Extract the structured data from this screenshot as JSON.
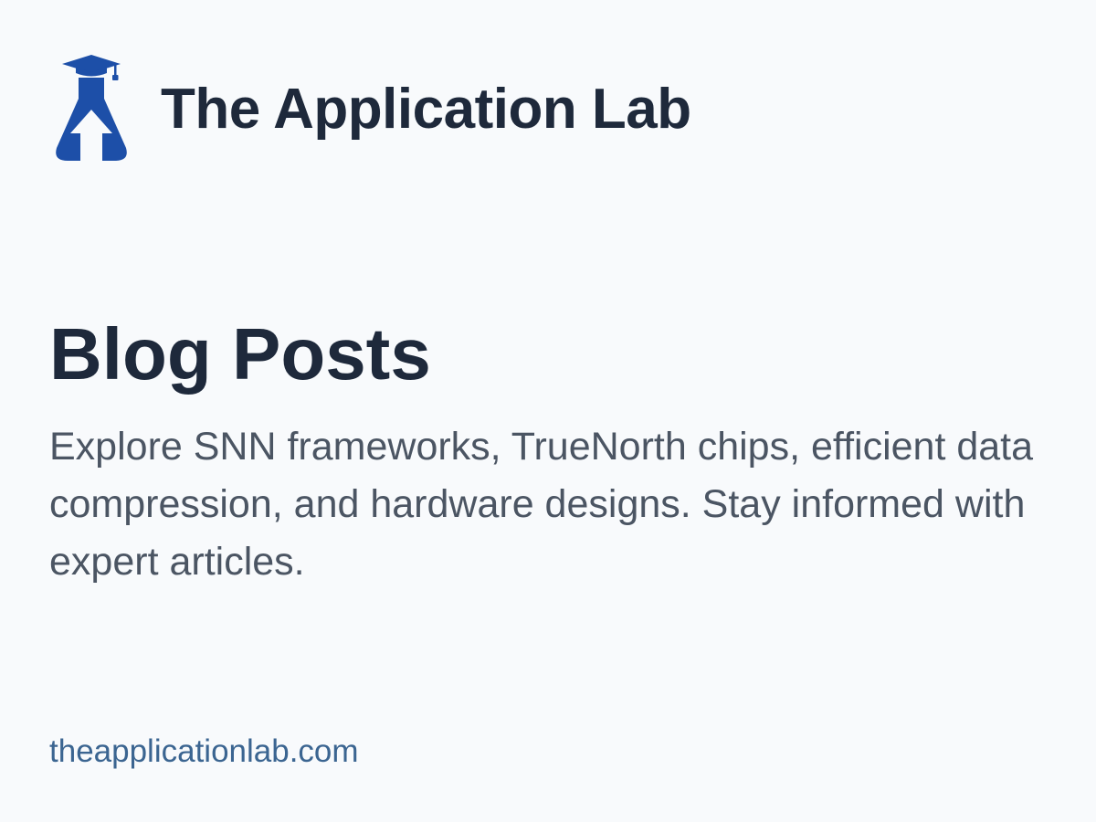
{
  "brand": {
    "name": "The Application Lab",
    "logo_icon": "graduation-cap-flask-arrow-icon",
    "logo_color": "#1d4fa8"
  },
  "main": {
    "title": "Blog Posts",
    "description": "Explore SNN frameworks, TrueNorth chips, efficient data compression, and hardware designs. Stay informed with expert articles."
  },
  "footer": {
    "url": "theapplicationlab.com"
  },
  "colors": {
    "background": "#f8fafc",
    "heading": "#1e293b",
    "body_text": "#4b5563",
    "link": "#3b6591"
  }
}
